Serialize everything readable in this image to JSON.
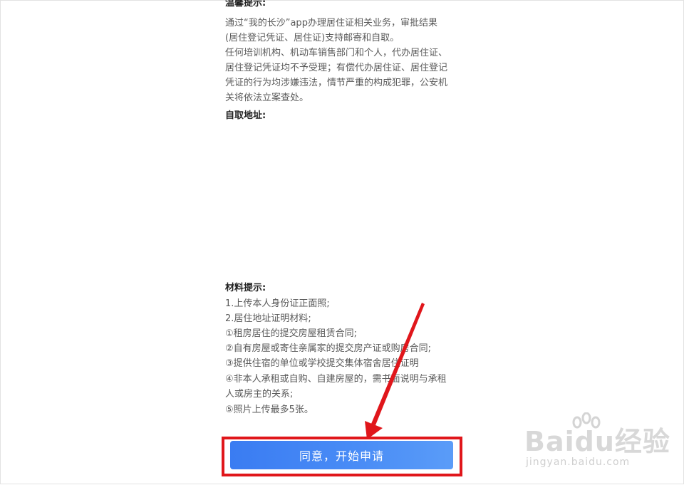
{
  "notice": {
    "heading": "温馨提示:",
    "lines": [
      "通过“我的长沙”app办理居住证相关业务，审批结果",
      "(居住登记凭证、居住证)支持邮寄和自取。",
      "任何培训机构、机动车销售部门和个人，代办居住证、",
      "居住登记凭证均不予受理；有偿代办居住证、居住登记",
      "凭证的行为均涉嫌违法，情节严重的构成犯罪，公安机",
      "关将依法立案查处。"
    ]
  },
  "pickup": {
    "heading": "自取地址:"
  },
  "materials": {
    "heading": "材料提示:",
    "lines": [
      "1.上传本人身份证正面照;",
      "2.居住地址证明材料;",
      "①租房居住的提交房屋租赁合同;",
      "②自有房屋或寄住亲属家的提交房产证或购房合同;",
      "③提供住宿的单位或学校提交集体宿舍居住证明",
      "④非本人承租或自购、自建房屋的，需书面说明与承租",
      "人或房主的关系;",
      "⑤照片上传最多5张。"
    ]
  },
  "button": {
    "label": "同意，开始申请"
  },
  "watermark": {
    "brand": "Baidu经验",
    "url": "jingyan.baidu.com"
  },
  "colors": {
    "button": "#4a8df6",
    "highlight": "#e0161b",
    "arrow": "#e0161b"
  }
}
